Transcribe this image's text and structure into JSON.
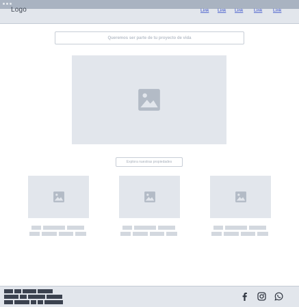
{
  "header": {
    "logo": "Logo",
    "nav_links": [
      "Link",
      "Link",
      "Link",
      "Link",
      "Link"
    ]
  },
  "hero": {
    "banner_text": "Queremos ser parte de tu proyecto de vida",
    "image_icon": "image-icon"
  },
  "properties": {
    "button_label": "Explora nuestras propiedades",
    "cards": [
      {
        "image_icon": "image-icon"
      },
      {
        "image_icon": "image-icon"
      },
      {
        "image_icon": "image-icon"
      }
    ]
  },
  "footer": {
    "social_icons": [
      "facebook-icon",
      "instagram-icon",
      "whatsapp-icon"
    ]
  },
  "colors": {
    "placeholder": "#e2e6ec",
    "link": "#5b6fd0",
    "footer_text": "#3b424f"
  }
}
